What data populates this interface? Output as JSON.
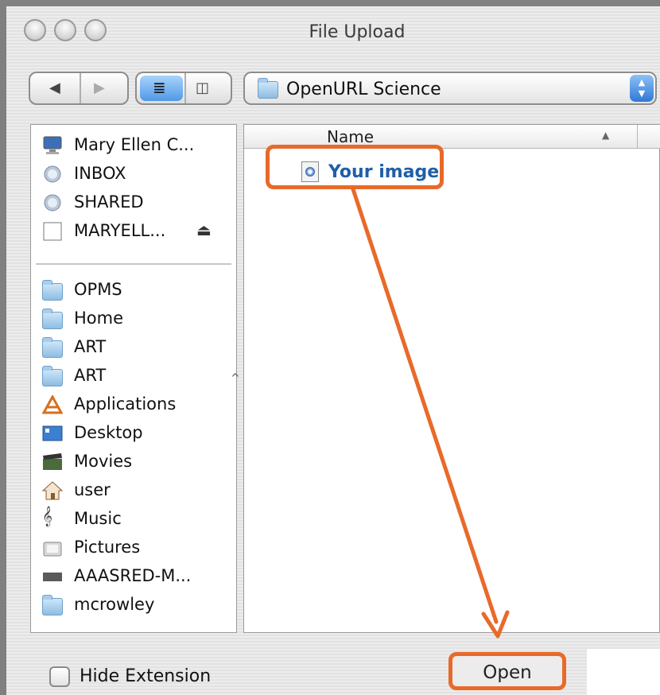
{
  "window": {
    "title": "File Upload"
  },
  "toolbar": {
    "location": "OpenURL Science"
  },
  "sidebar": {
    "devices": [
      {
        "label": "Mary Ellen C...",
        "icon": "computer-icon"
      },
      {
        "label": "INBOX",
        "icon": "network-globe-icon"
      },
      {
        "label": "SHARED",
        "icon": "network-globe-icon"
      },
      {
        "label": "MARYELL...",
        "icon": "disk-icon",
        "eject": "⏏"
      }
    ],
    "places": [
      {
        "label": "OPMS",
        "icon": "folder-icon"
      },
      {
        "label": "Home",
        "icon": "folder-icon"
      },
      {
        "label": "ART",
        "icon": "folder-icon"
      },
      {
        "label": "ART",
        "icon": "folder-icon"
      },
      {
        "label": "Applications",
        "icon": "applications-icon"
      },
      {
        "label": "Desktop",
        "icon": "desktop-icon"
      },
      {
        "label": "Movies",
        "icon": "movies-icon"
      },
      {
        "label": "user",
        "icon": "home-icon"
      },
      {
        "label": "Music",
        "icon": "music-icon"
      },
      {
        "label": "Pictures",
        "icon": "pictures-icon"
      },
      {
        "label": "AAASRED-M...",
        "icon": "drive-icon"
      },
      {
        "label": "mcrowley",
        "icon": "folder-icon"
      }
    ]
  },
  "filelist": {
    "column_name": "Name",
    "files": [
      {
        "label": "Your image",
        "icon": "image-file-icon"
      }
    ]
  },
  "footer": {
    "hide_extension_label": "Hide Extension",
    "open_label": "Open"
  },
  "colors": {
    "annotation": "#e86a2a",
    "file_text": "#1f5fa8"
  }
}
